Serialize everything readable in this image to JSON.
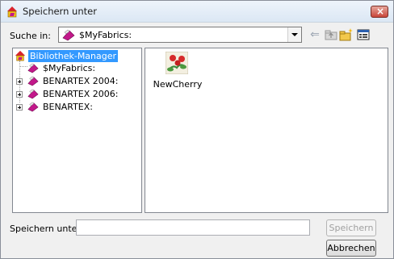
{
  "window": {
    "title": "Speichern unter"
  },
  "lookin": {
    "label": "Suche in:",
    "value": "$MyFabrics:"
  },
  "toolbar": {
    "back_icon": "back-arrow-icon",
    "up_icon": "up-folder-icon",
    "new_folder_icon": "new-folder-icon",
    "view_icon": "view-menu-icon"
  },
  "tree": {
    "items": [
      {
        "label": "Bibliothek-Manager",
        "selected": true,
        "expandable": false,
        "level": 0
      },
      {
        "label": "$MyFabrics:",
        "selected": false,
        "expandable": false,
        "level": 1
      },
      {
        "label": "BENARTEX 2004:",
        "selected": false,
        "expandable": true,
        "level": 1
      },
      {
        "label": "BENARTEX 2006:",
        "selected": false,
        "expandable": true,
        "level": 1
      },
      {
        "label": "BENARTEX:",
        "selected": false,
        "expandable": true,
        "level": 1
      }
    ]
  },
  "files": [
    {
      "name": "NewCherry",
      "icon": "fabric-thumbnail-icon"
    }
  ],
  "saveas": {
    "label": "Speichern unter:",
    "value": ""
  },
  "buttons": {
    "save": "Speichern",
    "cancel": "Abbrechen",
    "save_enabled": false
  },
  "colors": {
    "selection": "#3399ff",
    "library_icon_fill": "#c2188a"
  }
}
